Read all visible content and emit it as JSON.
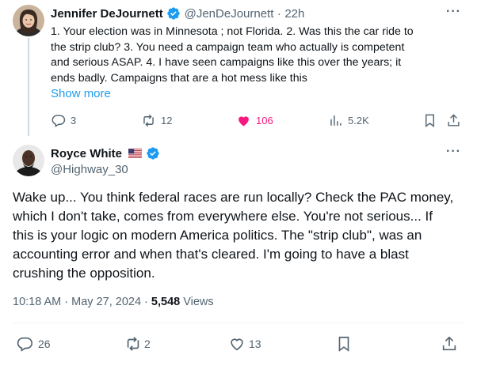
{
  "reply": {
    "name": "Jennifer DeJournett",
    "handle": "@JenDeJournett",
    "separator": "·",
    "time": "22h",
    "more": "···",
    "lines": [
      "1.  Your election was in Minnesota ; not Florida.  2.  Was this the car ride to",
      "the strip club? 3.  You need a campaign team who actually is competent",
      "and serious ASAP.  4.  I have seen campaigns like this over the years; it",
      "ends badly.  Campaigns that are a hot mess like this"
    ],
    "show_more": "Show more",
    "actions": {
      "replies": "3",
      "reposts": "12",
      "likes": "106",
      "views": "5.2K"
    }
  },
  "main": {
    "name": "Royce White",
    "handle": "@Highway_30",
    "more": "···",
    "paragraph_lines": [
      "Wake up... You think federal races are run locally? Check the PAC money,",
      "which I don't take, comes from everywhere else. You're not serious... If",
      "this is your logic on modern America politics. The \"strip club\", was an",
      "accounting error and when that's cleared. I'm going to have a blast",
      "crushing the opposition."
    ],
    "timestamp": "10:18 AM · May 27, 2024 · ",
    "views_count": "5,548",
    "views_label": " Views",
    "actions": {
      "replies": "26",
      "reposts": "2",
      "likes": "13"
    }
  },
  "colors": {
    "like_active": "#f91880",
    "verified": "#1d9bf0",
    "link": "#1d9bf0",
    "muted": "#536471"
  }
}
